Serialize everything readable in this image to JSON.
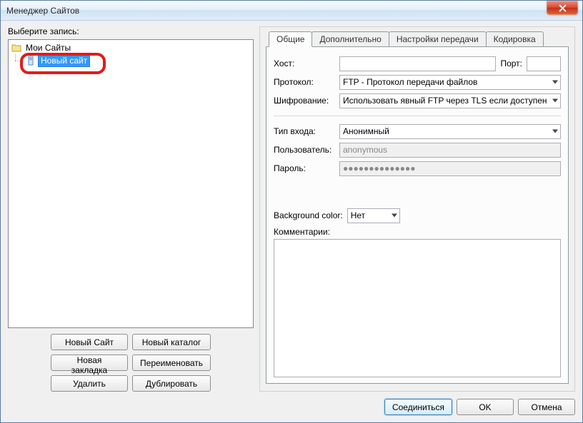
{
  "window": {
    "title": "Менеджер Сайтов"
  },
  "left": {
    "select_label": "Выберите запись:",
    "tree": {
      "root": "Мои Сайты",
      "selected": "Новый сайт"
    },
    "buttons": {
      "new_site": "Новый Сайт",
      "new_folder": "Новый каталог",
      "new_bookmark": "Новая закладка",
      "rename": "Переименовать",
      "delete": "Удалить",
      "duplicate": "Дублировать"
    }
  },
  "tabs": {
    "general": "Общие",
    "advanced": "Дополнительно",
    "transfer": "Настройки передачи",
    "charset": "Кодировка"
  },
  "form": {
    "host_label": "Хост:",
    "host_value": "",
    "port_label": "Порт:",
    "port_value": "",
    "protocol_label": "Протокол:",
    "protocol_value": "FTP - Протокол передачи файлов",
    "encryption_label": "Шифрование:",
    "encryption_value": "Использовать явный FTP через TLS если доступен",
    "logon_label": "Тип входа:",
    "logon_value": "Анонимный",
    "user_label": "Пользователь:",
    "user_value": "anonymous",
    "pass_label": "Пароль:",
    "pass_value": "●●●●●●●●●●●●●●",
    "bgcolor_label": "Background color:",
    "bgcolor_value": "Нет",
    "comments_label": "Комментарии:",
    "comments_value": ""
  },
  "bottom": {
    "connect": "Соединиться",
    "ok": "OK",
    "cancel": "Отмена"
  }
}
